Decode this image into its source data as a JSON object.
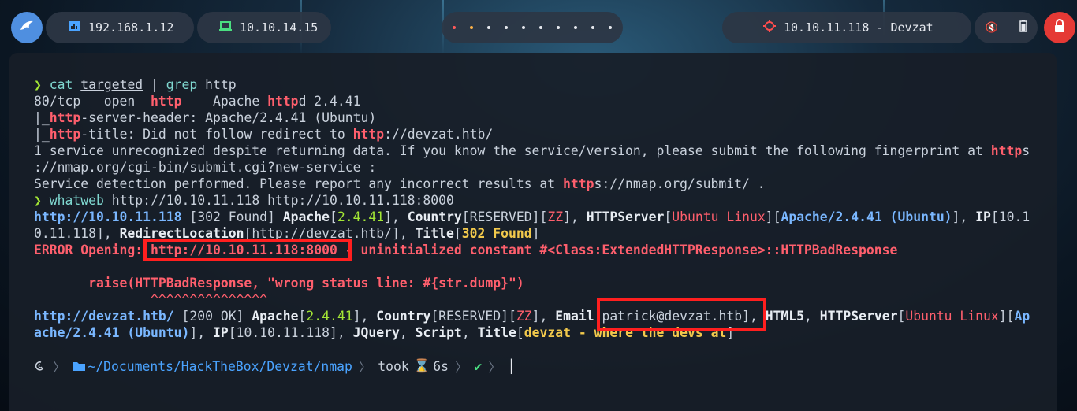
{
  "topbar": {
    "ip_local": "192.168.1.12",
    "ip_vpn": "10.10.14.15",
    "target": "10.10.11.118 - Devzat"
  },
  "terminal": {
    "lines": [
      {
        "parts": [
          [
            "g",
            "❯ "
          ],
          [
            "cy",
            "cat "
          ],
          [
            "ul",
            "targeted"
          ],
          [
            "dim",
            " | "
          ],
          [
            "cy",
            "grep "
          ],
          [
            "dim",
            "http"
          ]
        ]
      },
      {
        "parts": [
          [
            "dim",
            "80/tcp   open  "
          ],
          [
            "red",
            "http"
          ],
          [
            "dim",
            "    Apache "
          ],
          [
            "red",
            "http"
          ],
          [
            "dim",
            "d 2.4.41"
          ]
        ]
      },
      {
        "parts": [
          [
            "dim",
            "|_"
          ],
          [
            "red",
            "http"
          ],
          [
            "dim",
            "-server-header: Apache/2.4.41 (Ubuntu)"
          ]
        ]
      },
      {
        "parts": [
          [
            "dim",
            "|_"
          ],
          [
            "red",
            "http"
          ],
          [
            "dim",
            "-title: Did not follow redirect to "
          ],
          [
            "red",
            "http"
          ],
          [
            "dim",
            "://devzat.htb/"
          ]
        ]
      },
      {
        "parts": [
          [
            "dim",
            "1 service unrecognized despite returning data. If you know the service/version, please submit the following fingerprint at "
          ],
          [
            "red",
            "http"
          ],
          [
            "dim",
            "s"
          ]
        ]
      },
      {
        "parts": [
          [
            "dim",
            "://nmap.org/cgi-bin/submit.cgi?new-service :"
          ]
        ]
      },
      {
        "parts": [
          [
            "dim",
            "Service detection performed. Please report any incorrect results at "
          ],
          [
            "red",
            "http"
          ],
          [
            "dim",
            "s://nmap.org/submit/ ."
          ]
        ]
      },
      {
        "parts": [
          [
            "g",
            "❯ "
          ],
          [
            "cy",
            "whatweb "
          ],
          [
            "dim",
            "http://10.10.11.118 http://10.10.11.118:8000"
          ]
        ]
      },
      {
        "parts": [
          [
            "blue",
            "http://10.10.11.118"
          ],
          [
            "dim",
            " [302 Found] "
          ],
          [
            "white",
            "Apache"
          ],
          [
            "dim",
            "["
          ],
          [
            "g",
            "2.4.41"
          ],
          [
            "dim",
            "], "
          ],
          [
            "white",
            "Country"
          ],
          [
            "dim",
            "[RESERVED]["
          ],
          [
            "redn",
            "ZZ"
          ],
          [
            "dim",
            "], "
          ],
          [
            "white",
            "HTTPServer"
          ],
          [
            "dim",
            "["
          ],
          [
            "redn",
            "Ubuntu Linux"
          ],
          [
            "dim",
            "]["
          ],
          [
            "blue",
            "Apache/2.4.41 (Ubuntu)"
          ],
          [
            "dim",
            "], "
          ],
          [
            "white",
            "IP"
          ],
          [
            "dim",
            "[10.1"
          ]
        ]
      },
      {
        "parts": [
          [
            "dim",
            "0.11.118], "
          ],
          [
            "white",
            "RedirectLocation"
          ],
          [
            "dim",
            "[http://devzat.htb/], "
          ],
          [
            "white",
            "Title"
          ],
          [
            "dim",
            "["
          ],
          [
            "yel",
            "302 Found"
          ],
          [
            "dim",
            "]"
          ]
        ]
      },
      {
        "parts": [
          [
            "red",
            "ERROR Opening: http://10.10.11.118:8000 - uninitialized constant #<Class:ExtendedHTTPResponse>::HTTPBadResponse"
          ]
        ]
      },
      {
        "parts": [
          [
            "dim",
            ""
          ]
        ]
      },
      {
        "parts": [
          [
            "red",
            "       raise(HTTPBadResponse, \"wrong status line: #{str.dump}\")"
          ]
        ]
      },
      {
        "parts": [
          [
            "redn",
            "               ^^^^^^^^^^^^^^^"
          ]
        ]
      },
      {
        "parts": [
          [
            "blue",
            "http://devzat.htb/"
          ],
          [
            "dim",
            " [200 OK] "
          ],
          [
            "white",
            "Apache"
          ],
          [
            "dim",
            "["
          ],
          [
            "g",
            "2.4.41"
          ],
          [
            "dim",
            "], "
          ],
          [
            "white",
            "Country"
          ],
          [
            "dim",
            "[RESERVED]["
          ],
          [
            "redn",
            "ZZ"
          ],
          [
            "dim",
            "], "
          ],
          [
            "white",
            "Email"
          ],
          [
            "dim",
            "[patrick@devzat.htb], "
          ],
          [
            "white",
            "HTML5"
          ],
          [
            "dim",
            ", "
          ],
          [
            "white",
            "HTTPServer"
          ],
          [
            "dim",
            "["
          ],
          [
            "redn",
            "Ubuntu Linux"
          ],
          [
            "dim",
            "]["
          ],
          [
            "blue",
            "Ap"
          ]
        ]
      },
      {
        "parts": [
          [
            "blue",
            "ache/2.4.41 (Ubuntu)"
          ],
          [
            "dim",
            "], "
          ],
          [
            "white",
            "IP"
          ],
          [
            "dim",
            "[10.10.11.118], "
          ],
          [
            "white",
            "JQuery"
          ],
          [
            "dim",
            ", "
          ],
          [
            "white",
            "Script"
          ],
          [
            "dim",
            ", "
          ],
          [
            "white",
            "Title"
          ],
          [
            "dim",
            "["
          ],
          [
            "yel",
            "devzat - where the devs at"
          ],
          [
            "dim",
            "]"
          ]
        ]
      }
    ],
    "prompt": {
      "path": "~/Documents/HackTheBox/Devzat/nmap",
      "took_label": "took",
      "duration": "6s",
      "status": "✔"
    }
  }
}
